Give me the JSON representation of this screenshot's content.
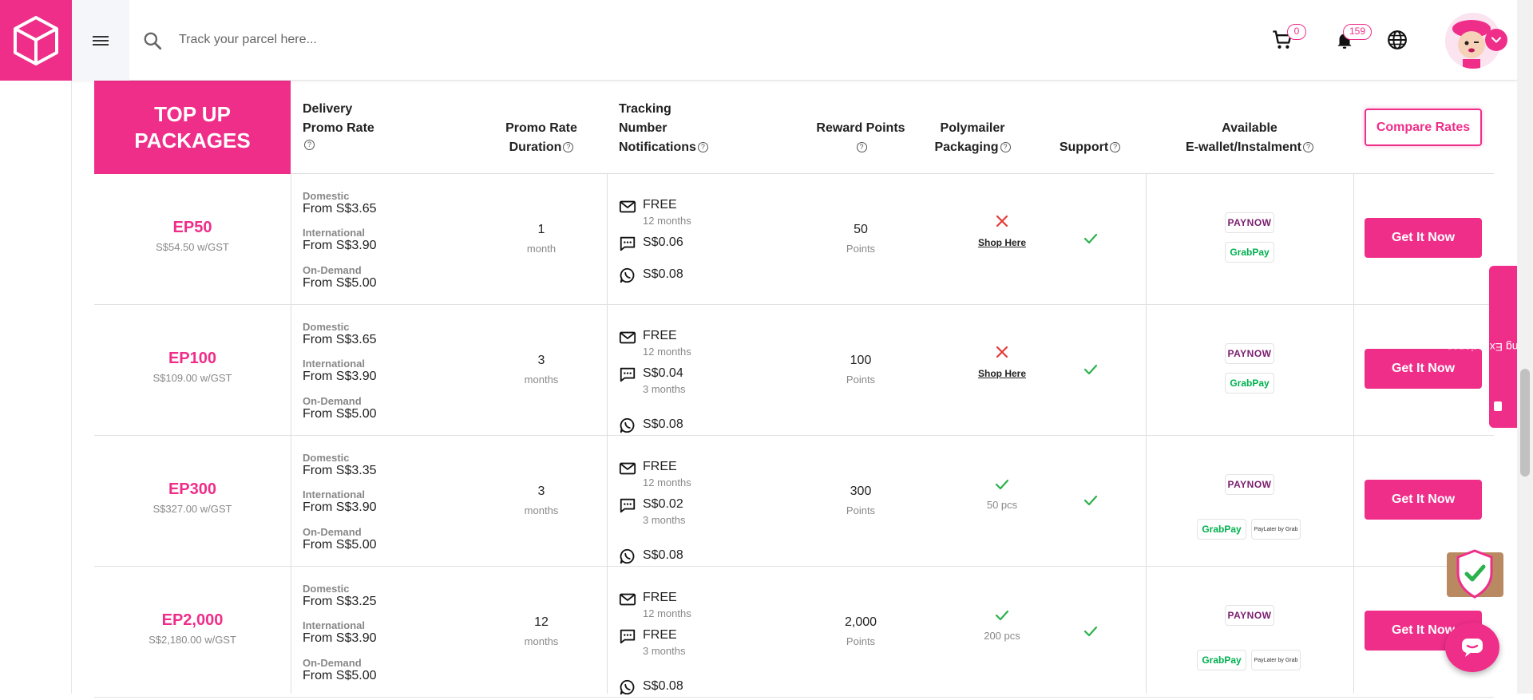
{
  "colors": {
    "brand": "#ef2e8a",
    "check": "#2bb24c",
    "cross": "#e53935"
  },
  "header": {
    "search_placeholder": "Track your parcel here...",
    "cart_count": "0",
    "notification_count": "159"
  },
  "table": {
    "title_line1": "TOP UP",
    "title_line2": "PACKAGES",
    "columns": {
      "delivery_line1": "Delivery",
      "delivery_line2": "Promo Rate",
      "duration_line1": "Promo Rate",
      "duration_line2": "Duration",
      "tracking_line1": "Tracking",
      "tracking_line2": "Number",
      "tracking_line3": "Notifications",
      "reward": "Reward Points",
      "poly_line1": "Polymailer",
      "poly_line2": "Packaging",
      "support": "Support",
      "wallet_line1": "Available",
      "wallet_line2": "E-wallet/Instalment"
    },
    "compare_label": "Compare Rates",
    "labels": {
      "domestic": "Domestic",
      "international": "International",
      "on_demand": "On-Demand",
      "shop_here": "Shop Here",
      "points": "Points",
      "get_it_now": "Get It Now",
      "paynow": "PAYNOW",
      "grabpay": "GrabPay",
      "paylater": "PayLater by Grab"
    },
    "packages": [
      {
        "name": "EP50",
        "price": "S$54.50 w/GST",
        "domestic": "From S$3.65",
        "international": "From S$3.90",
        "on_demand": "From S$5.00",
        "duration": "1",
        "duration_unit": "month",
        "email": "FREE",
        "email_sub": "12 months",
        "sms": "S$0.06",
        "sms_sub": "",
        "whatsapp": "S$0.08",
        "points": "50",
        "poly": "",
        "poly_available": false
      },
      {
        "name": "EP100",
        "price": "S$109.00 w/GST",
        "domestic": "From S$3.65",
        "international": "From S$3.90",
        "on_demand": "From S$5.00",
        "duration": "3",
        "duration_unit": "months",
        "email": "FREE",
        "email_sub": "12 months",
        "sms": "S$0.04",
        "sms_sub": "3 months",
        "whatsapp": "S$0.08",
        "points": "100",
        "poly": "",
        "poly_available": false
      },
      {
        "name": "EP300",
        "price": "S$327.00 w/GST",
        "domestic": "From S$3.35",
        "international": "From S$3.90",
        "on_demand": "From S$5.00",
        "duration": "3",
        "duration_unit": "months",
        "email": "FREE",
        "email_sub": "12 months",
        "sms": "S$0.02",
        "sms_sub": "3 months",
        "whatsapp": "S$0.08",
        "points": "300",
        "poly": "50 pcs",
        "poly_available": true
      },
      {
        "name": "EP2,000",
        "price": "S$2,180.00 w/GST",
        "domestic": "From S$3.25",
        "international": "From S$3.90",
        "on_demand": "From S$5.00",
        "duration": "12",
        "duration_unit": "months",
        "email": "FREE",
        "email_sub": "12 months",
        "sms": "FREE",
        "sms_sub": "3 months",
        "whatsapp": "S$0.08",
        "points": "2,000",
        "poly": "200 pcs",
        "poly_available": true
      }
    ]
  },
  "side": {
    "rate_booking": "Rate Booking Experience"
  }
}
